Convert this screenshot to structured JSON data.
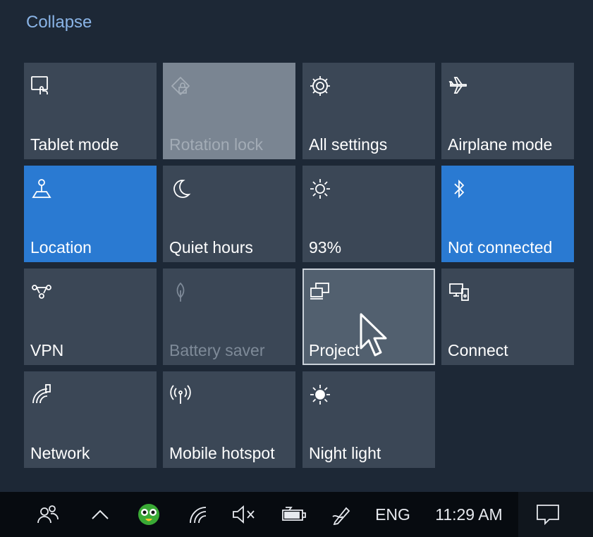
{
  "panel": {
    "collapse_label": "Collapse"
  },
  "tiles": [
    {
      "label": "Tablet mode",
      "icon": "tablet-mode-icon",
      "state": "off"
    },
    {
      "label": "Rotation lock",
      "icon": "rotation-lock-icon",
      "state": "disabled"
    },
    {
      "label": "All settings",
      "icon": "gear-icon",
      "state": "off"
    },
    {
      "label": "Airplane mode",
      "icon": "airplane-icon",
      "state": "off"
    },
    {
      "label": "Location",
      "icon": "location-icon",
      "state": "on"
    },
    {
      "label": "Quiet hours",
      "icon": "moon-icon",
      "state": "off"
    },
    {
      "label": "93%",
      "icon": "brightness-icon",
      "state": "off"
    },
    {
      "label": "Not connected",
      "icon": "bluetooth-icon",
      "state": "on"
    },
    {
      "label": "VPN",
      "icon": "vpn-icon",
      "state": "off"
    },
    {
      "label": "Battery saver",
      "icon": "battery-saver-icon",
      "state": "disabled"
    },
    {
      "label": "Project",
      "icon": "project-icon",
      "state": "hover"
    },
    {
      "label": "Connect",
      "icon": "connect-icon",
      "state": "off"
    },
    {
      "label": "Network",
      "icon": "network-icon",
      "state": "off"
    },
    {
      "label": "Mobile hotspot",
      "icon": "mobile-hotspot-icon",
      "state": "off"
    },
    {
      "label": "Night light",
      "icon": "night-light-icon",
      "state": "off"
    }
  ],
  "taskbar": {
    "language": "ENG",
    "time": "11:29 AM",
    "icons": [
      "people-icon",
      "chevron-up-icon",
      "app-icon",
      "wifi-icon",
      "volume-muted-icon",
      "battery-icon",
      "pen-icon",
      "notification-icon"
    ]
  },
  "colors": {
    "active_tile": "#2a7ad2",
    "tile": "#3b4756",
    "panel": "#1d2836",
    "accent_text": "#8ab4e6"
  }
}
